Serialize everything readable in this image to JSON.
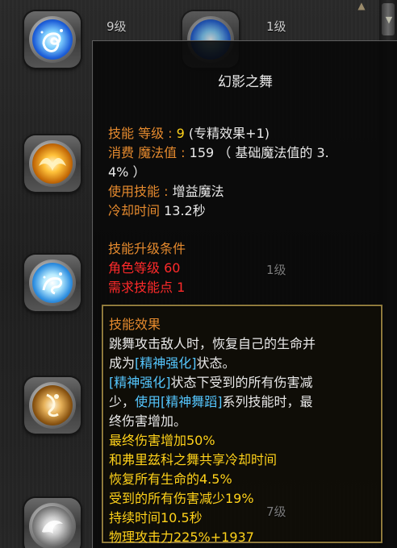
{
  "background": {
    "levels": [
      "9级",
      "1级",
      "1级",
      "7级"
    ],
    "slots": [
      {
        "icon": "blue-swirl-skill-icon"
      },
      {
        "icon": "golden-wings-skill-icon"
      },
      {
        "icon": "ice-crystal-skill-icon"
      },
      {
        "icon": "amber-dancer-skill-icon"
      },
      {
        "icon": "grey-dragon-skill-icon"
      },
      {
        "icon": "top-right-skill-icon"
      }
    ],
    "scroll": {
      "up_glyph": "▲",
      "down_glyph": "▼"
    }
  },
  "tooltip": {
    "title": "幻影之舞",
    "skill_level": {
      "label": "技能 等级",
      "sep": " : ",
      "value": "9",
      "suffix": " (专精效果+1)"
    },
    "mana_cost": {
      "label": "消费 魔法值",
      "sep": " : ",
      "value": "159 （ 基础魔法值的 3.",
      "value_cont": "4% ）"
    },
    "use_skill": {
      "label": "使用技能",
      "sep": " : ",
      "value": "增益魔法"
    },
    "cooldown": {
      "label": "冷却时间",
      "value": " 13.2秒"
    },
    "upgrade_condition": {
      "label": "技能升级条件"
    },
    "char_level_req": {
      "label": "角色等级 60"
    },
    "skill_point_req": {
      "label": "需求技能点 1"
    },
    "effect": {
      "header": "技能效果",
      "desc": [
        "跳舞攻击敌人时，恢复自己的生命并",
        "成为",
        "[精神强化]",
        "状态。",
        "[精神强化]",
        "状态下受到的所有伤害减",
        "少，",
        "使用",
        "[精神舞蹈]",
        "系列技能时，最",
        "终伤害增加。"
      ],
      "stats": [
        "最终伤害增加50%",
        "和弗里兹科之舞共享冷却时间",
        "恢复所有生命的4.5%",
        "受到的所有伤害减少19%",
        "持续时间10.5秒",
        "物理攻击力225%+1937"
      ]
    }
  },
  "colors": {
    "label_orange": "#e58a2e",
    "value_white": "#e9e9e9",
    "value_yellow": "#ffd21a",
    "requirement_red": "#ff2a2a",
    "keyword_cyan": "#55c7ff",
    "effect_border": "#8f7a3c"
  }
}
